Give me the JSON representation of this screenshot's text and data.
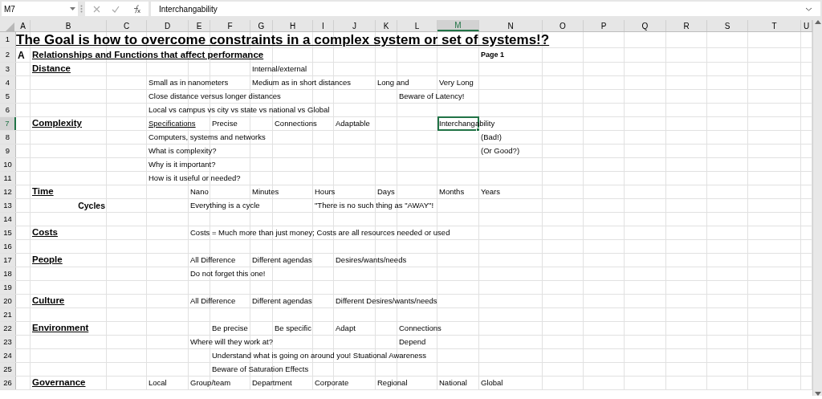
{
  "name_box": "M7",
  "formula": "Interchangability",
  "columns": [
    {
      "label": "A",
      "selected": false
    },
    {
      "label": "B",
      "selected": false
    },
    {
      "label": "C",
      "selected": false
    },
    {
      "label": "D",
      "selected": false
    },
    {
      "label": "E",
      "selected": false
    },
    {
      "label": "F",
      "selected": false
    },
    {
      "label": "G",
      "selected": false
    },
    {
      "label": "H",
      "selected": false
    },
    {
      "label": "I",
      "selected": false
    },
    {
      "label": "J",
      "selected": false
    },
    {
      "label": "K",
      "selected": false
    },
    {
      "label": "L",
      "selected": false
    },
    {
      "label": "M",
      "selected": true
    },
    {
      "label": "N",
      "selected": false
    },
    {
      "label": "O",
      "selected": false
    },
    {
      "label": "P",
      "selected": false
    },
    {
      "label": "Q",
      "selected": false
    },
    {
      "label": "R",
      "selected": false
    },
    {
      "label": "S",
      "selected": false
    },
    {
      "label": "T",
      "selected": false
    },
    {
      "label": "U",
      "selected": false
    }
  ],
  "rows": [
    {
      "number": "1",
      "selected": false,
      "cells": {
        "A": {
          "kind": "title",
          "text": "The Goal is how to overcome constraints in a complex system or set of systems!?"
        }
      }
    },
    {
      "number": "2",
      "selected": false,
      "cells": {
        "A": {
          "kind": "section",
          "text": "A"
        },
        "B": {
          "kind": "heading",
          "text": "Relationships and Functions that affect performance"
        },
        "N": {
          "kind": "note",
          "text": "Page 1"
        }
      }
    },
    {
      "number": "3",
      "selected": false,
      "cells": {
        "B": {
          "kind": "heading",
          "text": "Distance"
        },
        "G": {
          "kind": "text",
          "text": "Internal/external"
        }
      }
    },
    {
      "number": "4",
      "selected": false,
      "cells": {
        "D": {
          "kind": "text",
          "text": "Small as in nanometers"
        },
        "G": {
          "kind": "text",
          "text": "Medium as in short distances"
        },
        "K": {
          "kind": "text",
          "text": "Long and"
        },
        "M": {
          "kind": "text",
          "text": "Very Long"
        }
      }
    },
    {
      "number": "5",
      "selected": false,
      "cells": {
        "D": {
          "kind": "text",
          "text": "Close distance versus longer distances"
        },
        "L": {
          "kind": "text",
          "text": "Beware of Latency!"
        }
      }
    },
    {
      "number": "6",
      "selected": false,
      "cells": {
        "D": {
          "kind": "text",
          "text": "Local vs campus vs city vs state vs national vs Global"
        }
      }
    },
    {
      "number": "7",
      "selected": true,
      "cells": {
        "B": {
          "kind": "heading",
          "text": "Complexity"
        },
        "D": {
          "kind": "underlined",
          "text": "Specifications"
        },
        "F": {
          "kind": "text",
          "text": "Precise"
        },
        "H": {
          "kind": "text",
          "text": "Connections"
        },
        "J": {
          "kind": "text",
          "text": "Adaptable"
        },
        "M": {
          "kind": "text",
          "text": "Interchangability",
          "selected": true
        }
      }
    },
    {
      "number": "8",
      "selected": false,
      "cells": {
        "D": {
          "kind": "text",
          "text": "Computers, systems and networks"
        },
        "N": {
          "kind": "text",
          "text": "(Bad!)"
        }
      }
    },
    {
      "number": "9",
      "selected": false,
      "cells": {
        "D": {
          "kind": "text",
          "text": "What is complexity?"
        },
        "N": {
          "kind": "text",
          "text": "(Or Good?)"
        }
      }
    },
    {
      "number": "10",
      "selected": false,
      "cells": {
        "D": {
          "kind": "text",
          "text": "Why is it important?"
        }
      }
    },
    {
      "number": "11",
      "selected": false,
      "cells": {
        "D": {
          "kind": "text",
          "text": "How is it useful or needed?"
        }
      }
    },
    {
      "number": "12",
      "selected": false,
      "cells": {
        "B": {
          "kind": "heading",
          "text": "Time"
        },
        "E": {
          "kind": "text",
          "text": "Nano"
        },
        "G": {
          "kind": "text",
          "text": "Minutes"
        },
        "I": {
          "kind": "text",
          "text": "Hours"
        },
        "K": {
          "kind": "text",
          "text": "Days"
        },
        "M": {
          "kind": "text",
          "text": "Months"
        },
        "N": {
          "kind": "text",
          "text": "Years"
        }
      }
    },
    {
      "number": "13",
      "selected": false,
      "cells": {
        "B": {
          "kind": "sublabel",
          "text": "Cycles"
        },
        "E": {
          "kind": "text",
          "text": "Everything is a cycle"
        },
        "I": {
          "kind": "text",
          "text": "\"There is no such thing as \"AWAY\"!"
        }
      }
    },
    {
      "number": "14",
      "selected": false,
      "cells": {}
    },
    {
      "number": "15",
      "selected": false,
      "cells": {
        "B": {
          "kind": "heading",
          "text": "Costs"
        },
        "E": {
          "kind": "text",
          "text": "Costs = Much more than just money; Costs are all resources needed or used"
        }
      }
    },
    {
      "number": "16",
      "selected": false,
      "cells": {}
    },
    {
      "number": "17",
      "selected": false,
      "cells": {
        "B": {
          "kind": "heading",
          "text": "People"
        },
        "E": {
          "kind": "text",
          "text": "All Difference"
        },
        "G": {
          "kind": "text",
          "text": "Different  agendas"
        },
        "J": {
          "kind": "text",
          "text": "Desires/wants/needs"
        }
      }
    },
    {
      "number": "18",
      "selected": false,
      "cells": {
        "E": {
          "kind": "text",
          "text": "Do not forget this one!"
        }
      }
    },
    {
      "number": "19",
      "selected": false,
      "cells": {}
    },
    {
      "number": "20",
      "selected": false,
      "cells": {
        "B": {
          "kind": "heading",
          "text": "Culture"
        },
        "E": {
          "kind": "text",
          "text": "All Difference"
        },
        "G": {
          "kind": "text",
          "text": "Different  agendas"
        },
        "J": {
          "kind": "text",
          "text": "Different Desires/wants/needs"
        }
      }
    },
    {
      "number": "21",
      "selected": false,
      "cells": {}
    },
    {
      "number": "22",
      "selected": false,
      "cells": {
        "B": {
          "kind": "heading",
          "text": "Environment"
        },
        "F": {
          "kind": "text",
          "text": "Be precise"
        },
        "H": {
          "kind": "text",
          "text": "Be specific"
        },
        "J": {
          "kind": "text",
          "text": "Adapt"
        },
        "L": {
          "kind": "text",
          "text": "Connections"
        }
      }
    },
    {
      "number": "23",
      "selected": false,
      "cells": {
        "E": {
          "kind": "text",
          "text": "Where will they work at?"
        },
        "L": {
          "kind": "text",
          "text": "Depend"
        }
      }
    },
    {
      "number": "24",
      "selected": false,
      "cells": {
        "F": {
          "kind": "text",
          "text": "Understand what is going on around you!  Stuational Awareness"
        }
      }
    },
    {
      "number": "25",
      "selected": false,
      "cells": {
        "F": {
          "kind": "text",
          "text": "Beware of Saturation Effects"
        }
      }
    },
    {
      "number": "26",
      "selected": false,
      "cells": {
        "B": {
          "kind": "heading",
          "text": "Governance"
        },
        "D": {
          "kind": "text",
          "text": "Local"
        },
        "E": {
          "kind": "text",
          "text": "Group/team"
        },
        "G": {
          "kind": "text",
          "text": "Department"
        },
        "I": {
          "kind": "text",
          "text": "Corporate"
        },
        "K": {
          "kind": "text",
          "text": "Regional"
        },
        "M": {
          "kind": "text",
          "text": "National"
        },
        "N": {
          "kind": "text",
          "text": "Global"
        }
      }
    }
  ]
}
